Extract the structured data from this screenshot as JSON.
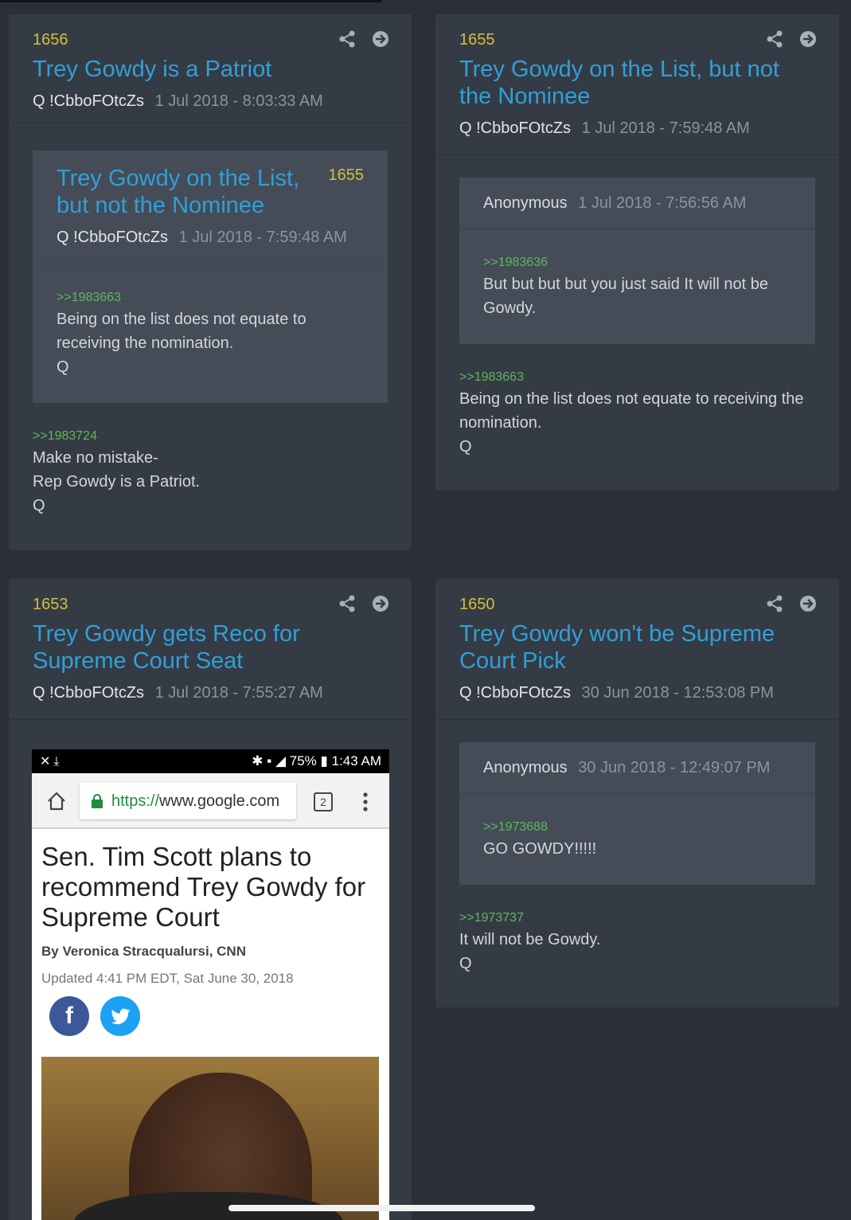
{
  "cards": [
    {
      "number": "1656",
      "title": "Trey Gowdy is a Patriot",
      "author": "Q !CbboFOtcZs",
      "date": "1 Jul 2018 - 8:03:33 AM",
      "quoted": {
        "title": "Trey Gowdy on the List, but not the Nominee",
        "number": "1655",
        "author": "Q !CbboFOtcZs",
        "date": "1 Jul 2018 - 7:59:48 AM",
        "ref": ">>1983663",
        "lines": [
          "Being on the list does not equate to receiving the nomination.",
          "Q"
        ]
      },
      "post": {
        "ref": ">>1983724",
        "lines": [
          "Make no mistake-",
          "Rep Gowdy is a Patriot.",
          "Q"
        ]
      }
    },
    {
      "number": "1655",
      "title": "Trey Gowdy on the List, but not the Nominee",
      "author": "Q !CbboFOtcZs",
      "date": "1 Jul 2018 - 7:59:48 AM",
      "quoted": {
        "author": "Anonymous",
        "date": "1 Jul 2018 - 7:56:56 AM",
        "ref": ">>1983636",
        "lines": [
          "But but but but you just said It will not be Gowdy."
        ]
      },
      "post": {
        "ref": ">>1983663",
        "lines": [
          "Being on the list does not equate to receiving the nomination.",
          "Q"
        ]
      }
    },
    {
      "number": "1653",
      "title": "Trey Gowdy gets Reco for Supreme Court Seat",
      "author": "Q !CbboFOtcZs",
      "date": "1 Jul 2018 - 7:55:27 AM",
      "screenshot": {
        "battery": "75%",
        "time": "1:43 AM",
        "url_scheme": "https://",
        "url_host": "www.google.com",
        "tab_count": "2",
        "headline": "Sen. Tim Scott plans to recommend Trey Gowdy for Supreme Court",
        "byline": "By Veronica Stracqualursi, CNN",
        "updated": "Updated 4:41 PM EDT, Sat June 30, 2018",
        "facebook_glyph": "f",
        "twitter_glyph": "t"
      }
    },
    {
      "number": "1650",
      "title": "Trey Gowdy won't be Supreme Court Pick",
      "author": "Q !CbboFOtcZs",
      "date": "30 Jun 2018 - 12:53:08 PM",
      "quoted": {
        "author": "Anonymous",
        "date": "30 Jun 2018 - 12:49:07 PM",
        "ref": ">>1973688",
        "lines": [
          "GO GOWDY!!!!!"
        ]
      },
      "post": {
        "ref": ">>1973737",
        "lines": [
          "It will not be Gowdy.",
          "Q"
        ]
      }
    }
  ],
  "colors": {
    "background": "#2a2f38",
    "card": "#353b45",
    "inner": "#454c57",
    "title_blue": "#2fa0d8",
    "number_yellow": "#d4bf3c",
    "ref_green": "#5cb85c"
  },
  "icons": [
    "share-icon",
    "arrow-right-circle-icon"
  ]
}
